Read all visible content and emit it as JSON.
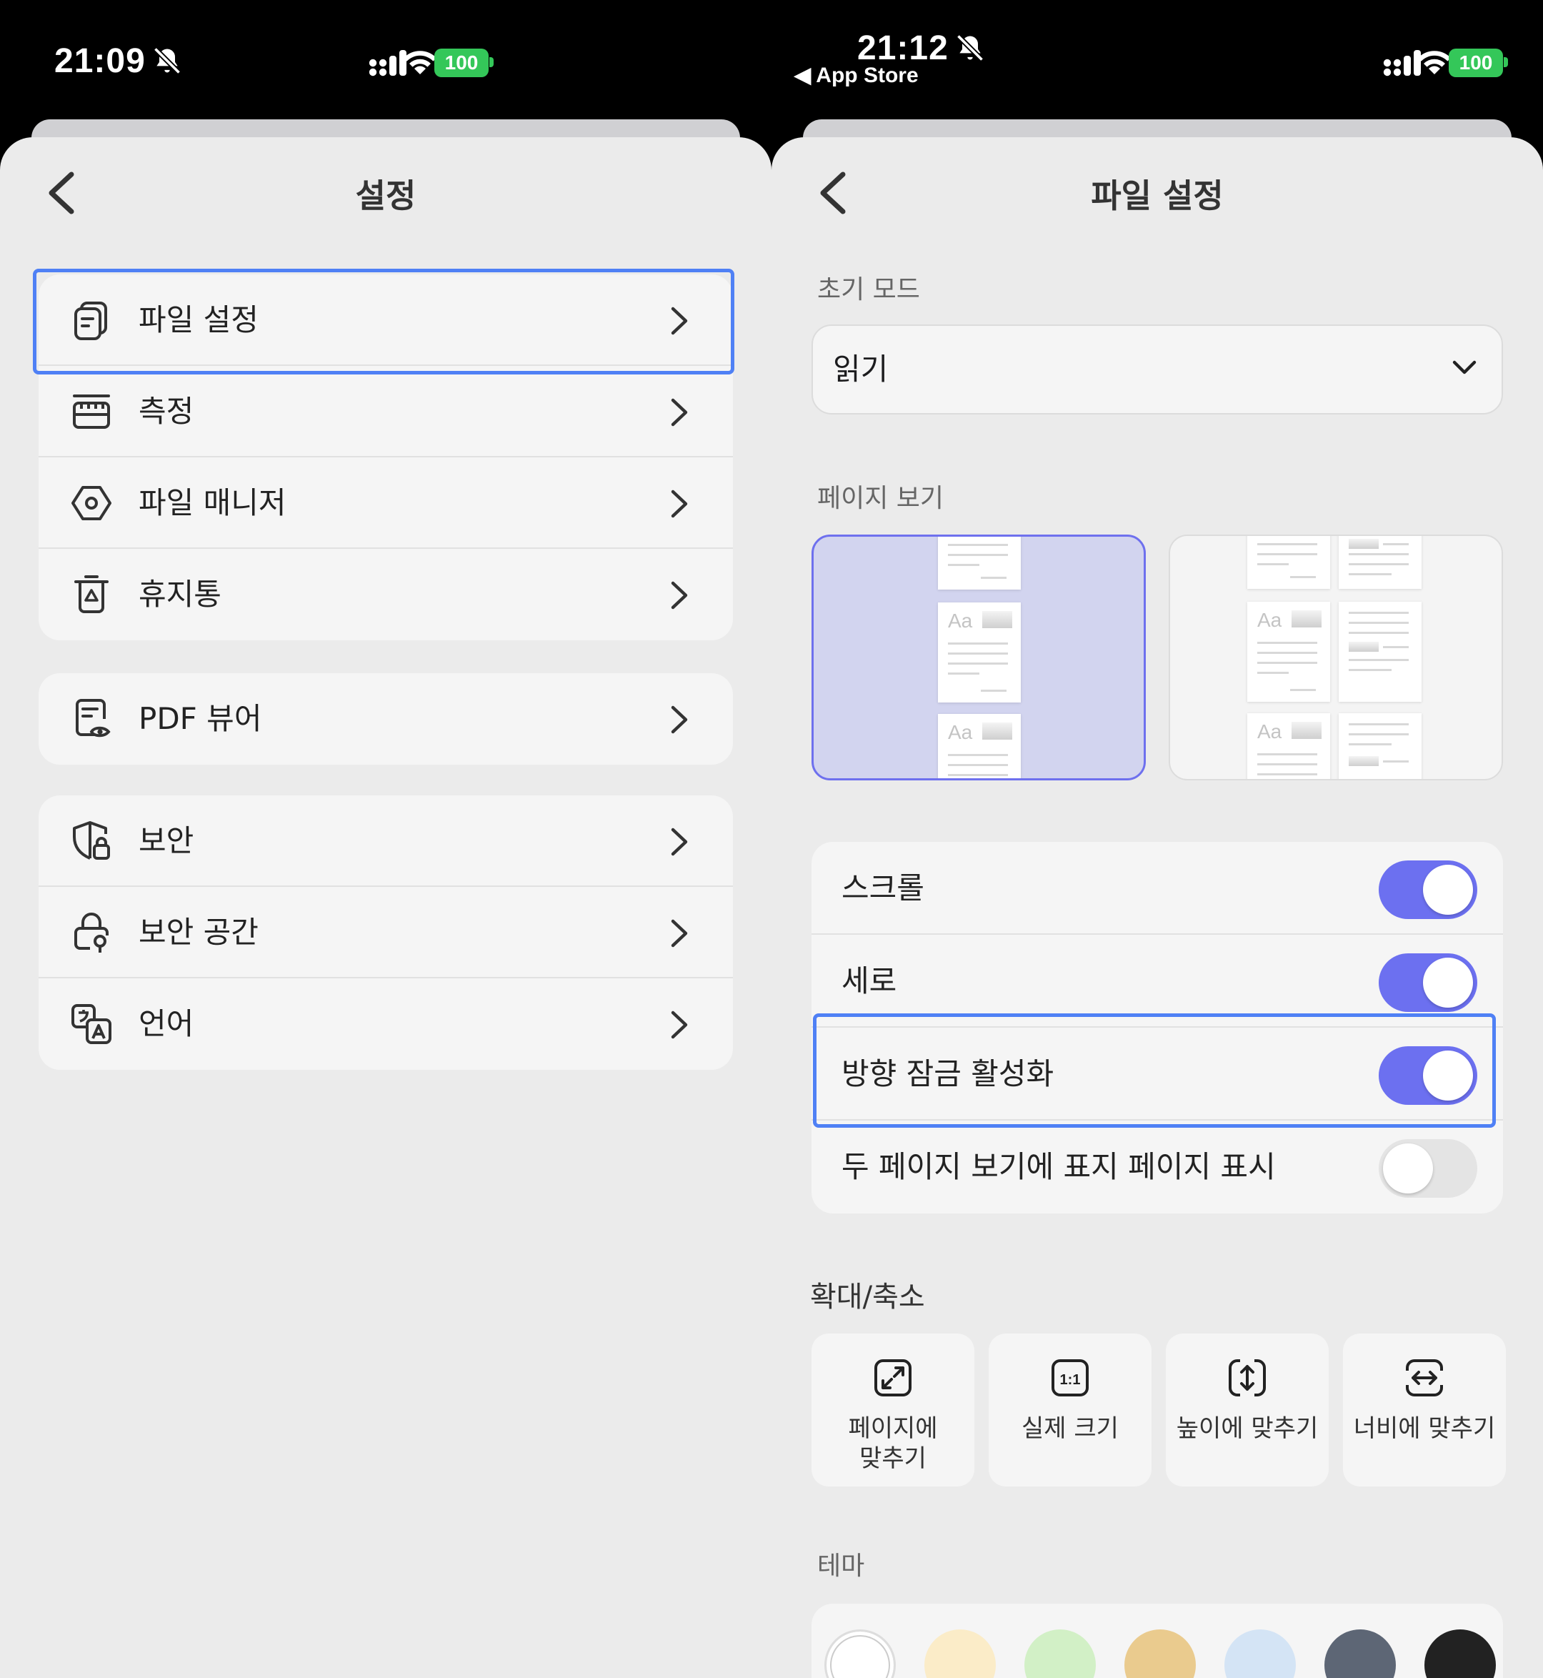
{
  "left": {
    "status": {
      "time": "21:09",
      "battery": "100"
    },
    "title": "설정",
    "groups": [
      {
        "items": [
          {
            "label": "파일 설정",
            "icon": "file-settings-icon"
          },
          {
            "label": "측정",
            "icon": "ruler-icon"
          },
          {
            "label": "파일 매니저",
            "icon": "hexagon-icon"
          },
          {
            "label": "휴지통",
            "icon": "trash-icon"
          }
        ]
      },
      {
        "items": [
          {
            "label": "PDF 뷰어",
            "icon": "pdf-viewer-icon"
          }
        ]
      },
      {
        "items": [
          {
            "label": "보안",
            "icon": "shield-lock-icon"
          },
          {
            "label": "보안 공간",
            "icon": "secure-space-icon"
          },
          {
            "label": "언어",
            "icon": "language-icon"
          }
        ]
      }
    ]
  },
  "right": {
    "status": {
      "time": "21:12",
      "back_app": "◀ App Store",
      "battery": "100"
    },
    "title": "파일 설정",
    "initial_mode": {
      "label": "초기 모드",
      "value": "읽기"
    },
    "page_view": {
      "label": "페이지 보기",
      "selected": "single"
    },
    "toggles": [
      {
        "label": "스크롤",
        "on": true
      },
      {
        "label": "세로",
        "on": true
      },
      {
        "label": "방향 잠금 활성화",
        "on": true
      },
      {
        "label": "두 페이지 보기에 표지 페이지 표시",
        "on": false
      }
    ],
    "zoom": {
      "label": "확대/축소",
      "options": [
        {
          "label": "페이지에\n맞추기",
          "icon": "fit-page-icon"
        },
        {
          "label": "실제 크기",
          "icon": "actual-size-icon",
          "icon_text": "1:1"
        },
        {
          "label": "높이에 맞추기",
          "icon": "fit-height-icon"
        },
        {
          "label": "너비에 맞추기",
          "icon": "fit-width-icon"
        }
      ]
    },
    "theme": {
      "label": "테마",
      "colors": [
        "#ffffff",
        "#fbecc8",
        "#d2f0c6",
        "#eacb8e",
        "#d4e4f5",
        "#5d6675",
        "#222222"
      ]
    }
  },
  "colors": {
    "accent": "#6c70f0",
    "highlight": "#4f80f5",
    "battery": "#34c759"
  }
}
